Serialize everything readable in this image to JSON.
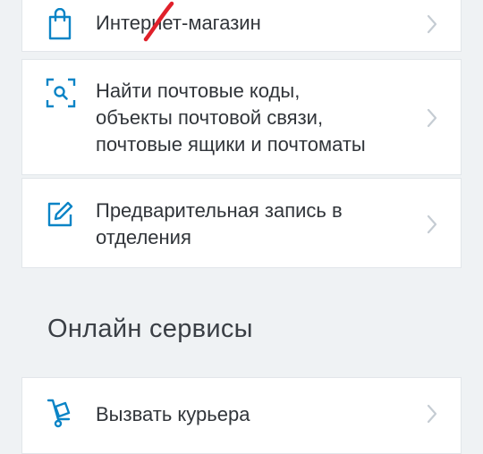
{
  "services": [
    {
      "icon": "shopping-bag-icon",
      "label": "Интернет-магазин"
    },
    {
      "icon": "search-scan-icon",
      "label": "Найти почтовые коды,\nобъекты почтовой связи,\nпочтовые ящики и почтоматы"
    },
    {
      "icon": "edit-pencil-icon",
      "label": "Предварительная запись в\nотделения"
    }
  ],
  "online_section": {
    "title": "Онлайн сервисы",
    "items": [
      {
        "icon": "courier-cart-icon",
        "label": "Вызвать курьера"
      }
    ]
  },
  "colors": {
    "icon_accent": "#0a84c6",
    "chevron": "#c5ccd3",
    "annotation_stroke": "#e0202a",
    "background": "#eff2f4"
  }
}
